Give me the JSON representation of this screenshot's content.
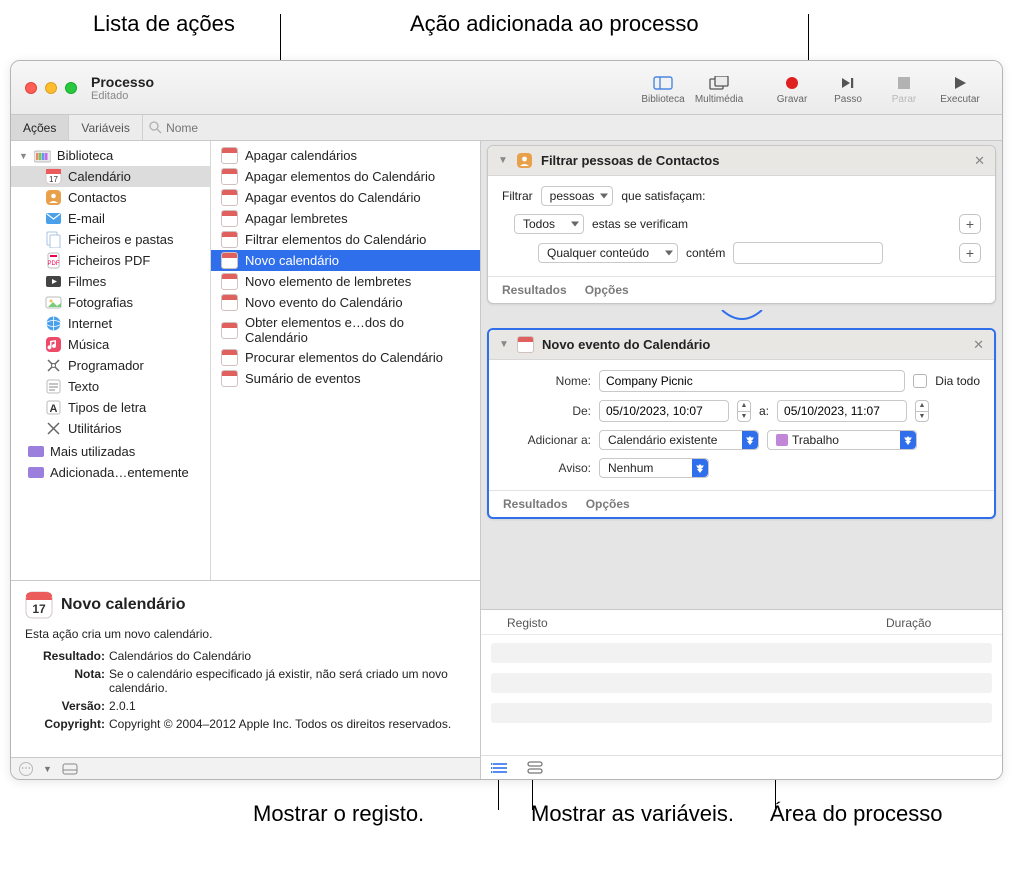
{
  "callouts": {
    "actions_list": "Lista de ações",
    "action_added": "Ação adicionada ao processo",
    "show_log": "Mostrar o registo.",
    "show_vars": "Mostrar as variáveis.",
    "workflow_area": "Área do processo"
  },
  "window": {
    "title": "Processo",
    "subtitle": "Editado"
  },
  "toolbar": {
    "library": "Biblioteca",
    "media": "Multimédia",
    "record": "Gravar",
    "step": "Passo",
    "stop": "Parar",
    "run": "Executar"
  },
  "tabs": {
    "actions": "Ações",
    "variables": "Variáveis",
    "search_placeholder": "Nome"
  },
  "sidebar": {
    "library": "Biblioteca",
    "items": [
      "Calendário",
      "Contactos",
      "E-mail",
      "Ficheiros e pastas",
      "Ficheiros PDF",
      "Filmes",
      "Fotografias",
      "Internet",
      "Música",
      "Programador",
      "Texto",
      "Tipos de letra",
      "Utilitários"
    ],
    "most_used": "Mais utilizadas",
    "recently_added": "Adicionada…entemente",
    "selected_index": 0
  },
  "actions_list": {
    "items": [
      "Apagar calendários",
      "Apagar elementos do Calendário",
      "Apagar eventos do Calendário",
      "Apagar lembretes",
      "Filtrar elementos do Calendário",
      "Novo calendário",
      "Novo elemento de lembretes",
      "Novo evento do Calendário",
      "Obter elementos e…dos do Calendário",
      "Procurar elementos do Calendário",
      "Sumário de eventos"
    ],
    "selected_index": 5
  },
  "detail": {
    "title": "Novo calendário",
    "description": "Esta ação cria um novo calendário.",
    "labels": {
      "result": "Resultado:",
      "note": "Nota:",
      "version": "Versão:",
      "copyright": "Copyright:"
    },
    "result": "Calendários do Calendário",
    "note": "Se o calendário especificado já existir, não será criado um novo calendário.",
    "version": "2.0.1",
    "copyright": "Copyright © 2004–2012 Apple Inc. Todos os direitos reservados."
  },
  "action1": {
    "title": "Filtrar pessoas de Contactos",
    "filter_label": "Filtrar",
    "filter_what": "pessoas",
    "filter_suffix": "que satisfaçam:",
    "scope": "Todos",
    "scope_suffix": "estas se verificam",
    "cond": "Qualquer conteúdo",
    "cond_op": "contém",
    "footer_results": "Resultados",
    "footer_options": "Opções"
  },
  "action2": {
    "title": "Novo evento do Calendário",
    "labels": {
      "name": "Nome:",
      "from": "De:",
      "to": "a:",
      "add_to": "Adicionar a:",
      "alert": "Aviso:",
      "all_day": "Dia todo"
    },
    "name_value": "Company Picnic",
    "from_value": "05/10/2023, 10:07",
    "to_value": "05/10/2023, 11:07",
    "add_to_value": "Calendário existente",
    "calendar_name": "Trabalho",
    "calendar_color": "#c186d8",
    "alert_value": "Nenhum",
    "footer_results": "Resultados",
    "footer_options": "Opções"
  },
  "log": {
    "col1": "Registo",
    "col2": "Duração"
  }
}
